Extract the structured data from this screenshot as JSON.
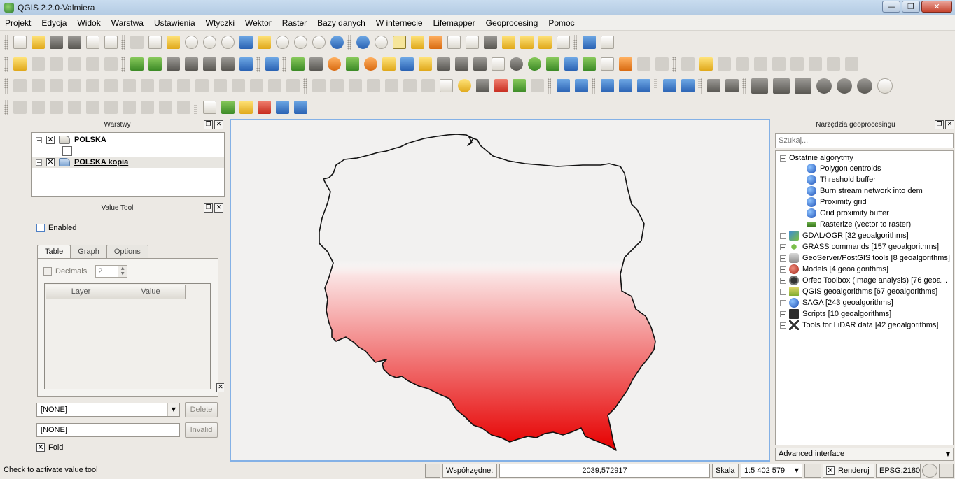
{
  "window": {
    "title": "QGIS 2.2.0-Valmiera",
    "minimize": "—",
    "maximize": "❐",
    "close": "✕"
  },
  "menu": [
    "Projekt",
    "Edycja",
    "Widok",
    "Warstwa",
    "Ustawienia",
    "Wtyczki",
    "Wektor",
    "Raster",
    "Bazy danych",
    "W internecie",
    "Lifemapper",
    "Geoprocesing",
    "Pomoc"
  ],
  "layers_panel": {
    "title": "Warstwy",
    "layers": [
      {
        "name": "POLSKA",
        "checked": true,
        "expander": "−"
      },
      {
        "name": "POLSKA kopia",
        "checked": true,
        "expander": "+"
      }
    ]
  },
  "value_tool": {
    "title": "Value Tool",
    "enabled_label": "Enabled",
    "tabs": [
      "Table",
      "Graph",
      "Options"
    ],
    "active_tab": "Table",
    "decimals_label": "Decimals",
    "decimals_value": "2",
    "columns": [
      "Layer",
      "Value"
    ],
    "combo_value": "[NONE]",
    "delete_label": "Delete",
    "input_value": "[NONE]",
    "invalid_label": "Invalid",
    "fold_label": "Fold",
    "fold_checked": true
  },
  "processing": {
    "title": "Narzędzia geoprocesingu",
    "search_placeholder": "Szukaj...",
    "recent_label": "Ostatnie algorytmy",
    "recent": [
      {
        "name": "Polygon centroids",
        "icon": "saga-icon"
      },
      {
        "name": "Threshold buffer",
        "icon": "saga-icon"
      },
      {
        "name": "Burn stream network into dem",
        "icon": "saga-icon"
      },
      {
        "name": "Proximity grid",
        "icon": "saga-icon"
      },
      {
        "name": "Grid proximity buffer",
        "icon": "saga-icon"
      },
      {
        "name": "Rasterize (vector to raster)",
        "icon": "raster-icon"
      }
    ],
    "providers": [
      {
        "name": "GDAL/OGR [32 geoalgorithms]",
        "icon": "gdal"
      },
      {
        "name": "GRASS commands [157 geoalgorithms]",
        "icon": "grass"
      },
      {
        "name": "GeoServer/PostGIS tools [8 geoalgorithms]",
        "icon": "db"
      },
      {
        "name": "Models [4 geoalgorithms]",
        "icon": "models"
      },
      {
        "name": "Orfeo Toolbox (Image analysis) [76 geoa...",
        "icon": "otb"
      },
      {
        "name": "QGIS geoalgorithms [67 geoalgorithms]",
        "icon": "qgis"
      },
      {
        "name": "SAGA [243 geoalgorithms]",
        "icon": "saga"
      },
      {
        "name": "Scripts [10 geoalgorithms]",
        "icon": "scripts"
      },
      {
        "name": "Tools for LiDAR data [42 geoalgorithms]",
        "icon": "lidar"
      }
    ],
    "interface_mode": "Advanced interface"
  },
  "status": {
    "hint": "Check to activate value tool",
    "coords_label": "Współrzędne:",
    "coords_value": "2039,572917",
    "scale_label": "Skala",
    "scale_value": "1:5 402 579",
    "render_label": "Renderuj",
    "render_checked": true,
    "epsg": "EPSG:2180"
  },
  "colors": {
    "accent": "#84b1e6",
    "fill_red": "#e60000"
  }
}
